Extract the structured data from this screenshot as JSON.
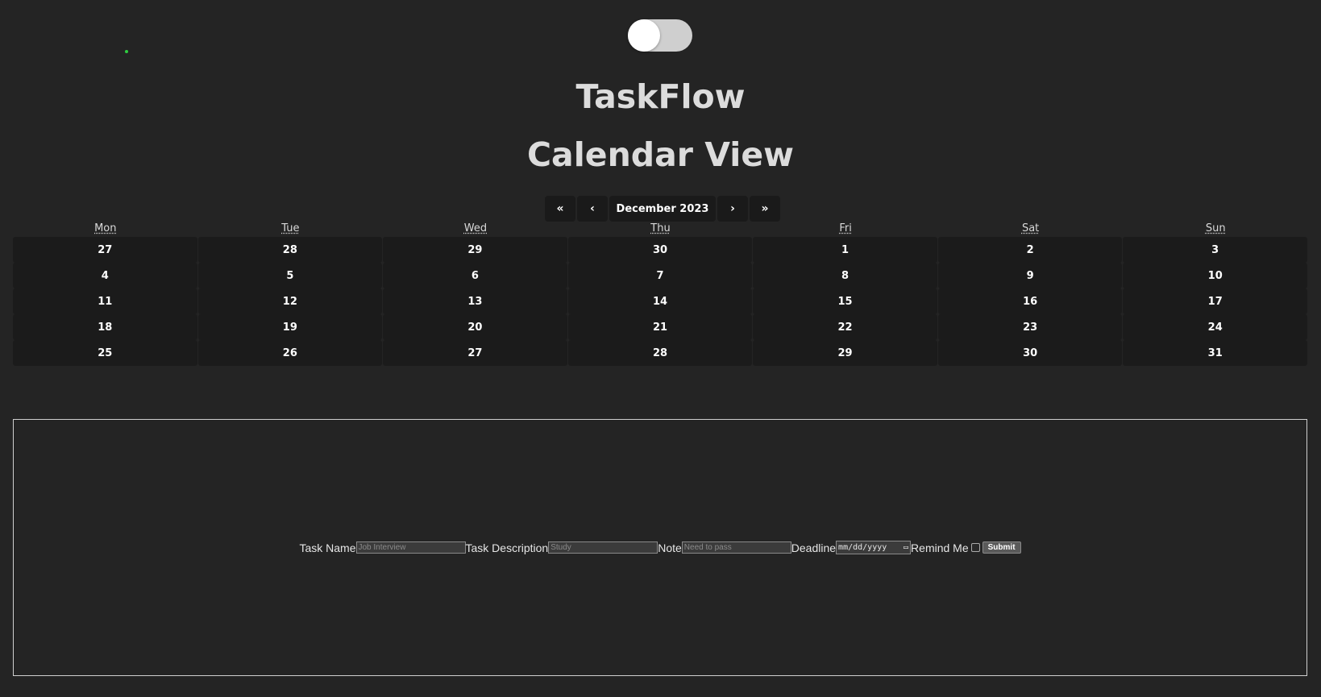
{
  "header": {
    "app_title": "TaskFlow",
    "view_title": "Calendar View"
  },
  "theme_toggle": {
    "state": "off"
  },
  "calendar": {
    "nav": {
      "prev_year": "«",
      "prev_month": "‹",
      "current_month": "December 2023",
      "next_month": "›",
      "next_year": "»"
    },
    "weekdays": [
      "Mon",
      "Tue",
      "Wed",
      "Thu",
      "Fri",
      "Sat",
      "Sun"
    ],
    "weeks": [
      [
        "27",
        "28",
        "29",
        "30",
        "1",
        "2",
        "3"
      ],
      [
        "4",
        "5",
        "6",
        "7",
        "8",
        "9",
        "10"
      ],
      [
        "11",
        "12",
        "13",
        "14",
        "15",
        "16",
        "17"
      ],
      [
        "18",
        "19",
        "20",
        "21",
        "22",
        "23",
        "24"
      ],
      [
        "25",
        "26",
        "27",
        "28",
        "29",
        "30",
        "31"
      ]
    ]
  },
  "task_form": {
    "task_name_label": "Task Name",
    "task_name_placeholder": "Job Interview",
    "task_description_label": "Task Description",
    "task_description_placeholder": "Study",
    "note_label": "Note",
    "note_placeholder": "Need to pass",
    "deadline_label": "Deadline",
    "deadline_placeholder": "mm/dd/yyyy",
    "remind_label": "Remind Me",
    "remind_checked": false,
    "submit_label": "Submit"
  },
  "colors": {
    "background": "#242424",
    "day_cell": "#1b1b1b",
    "status_dot": "#2ecc40"
  }
}
